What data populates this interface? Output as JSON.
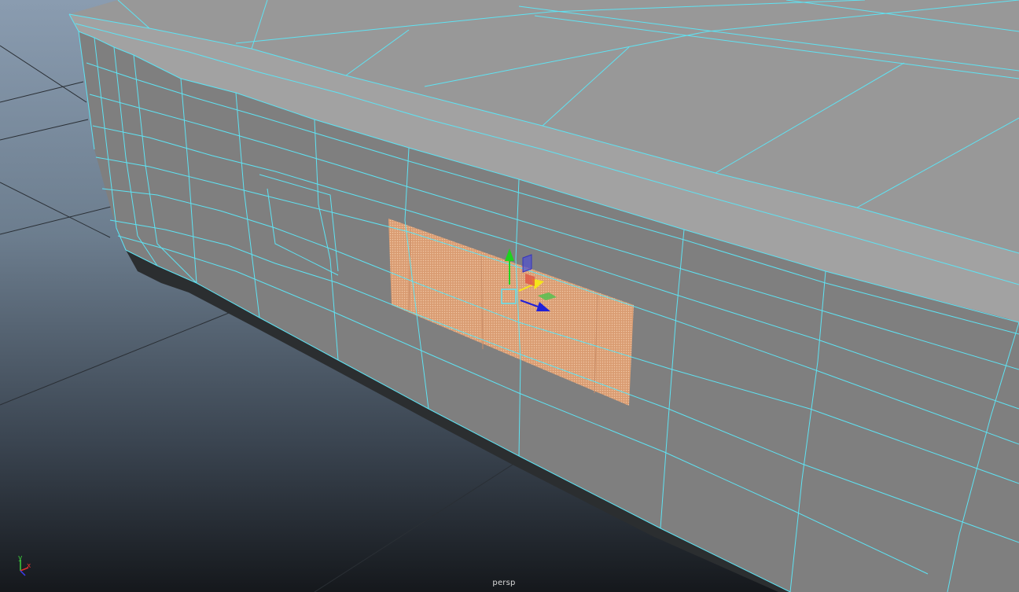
{
  "viewport": {
    "camera_name": "persp",
    "background_top": "#8a9cb0",
    "background_bottom": "#15181c"
  },
  "colors": {
    "wireframe": "#5ee3f3",
    "mesh_top": "#989898",
    "mesh_side": "#7f7f7f",
    "mesh_shadow": "#2b2e30",
    "grid": "#2a2f35",
    "face_selection": "#e0a176"
  },
  "manipulator": {
    "type": "move-manipulator",
    "icons": [
      "move-y-arrow-icon",
      "move-x-arrow-icon",
      "move-z-arrow-icon",
      "plane-xy-icon",
      "plane-xz-icon",
      "plane-yz-icon",
      "center-handle-icon"
    ],
    "axis_colors": {
      "x": "#e02020",
      "y": "#1fd21f",
      "z": "#2020d8",
      "active": "#f5e41b"
    }
  },
  "axis_indicator": {
    "y_label": "y",
    "x_label": "x",
    "z_label": "z",
    "y_color": "#3cd23c",
    "x_color": "#e03030",
    "z_color": "#3c3cf0"
  }
}
